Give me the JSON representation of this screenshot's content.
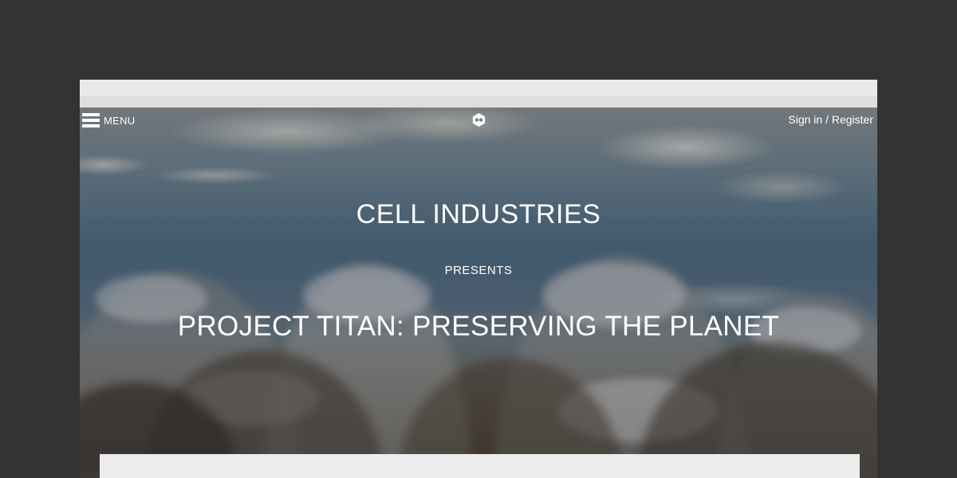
{
  "header": {
    "menu_label": "MENU",
    "menu_icon": "hamburger-icon",
    "logo_icon": "cell-logo-icon",
    "signin_label": "Sign in / Register"
  },
  "hero": {
    "brand": "CELL INDUSTRIES",
    "presents": "PRESENTS",
    "headline": "PROJECT TITAN: PRESERVING THE PLANET"
  },
  "colors": {
    "page_background": "#333333",
    "text": "#ffffff",
    "card": "#ececec"
  }
}
